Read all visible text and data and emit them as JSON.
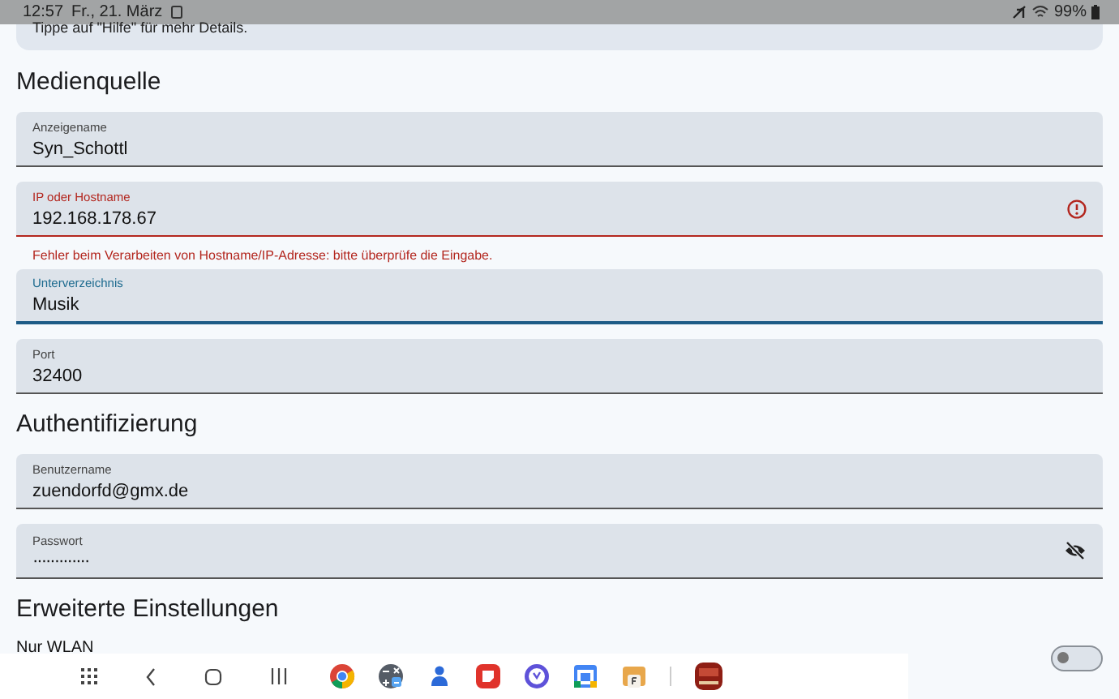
{
  "status_bar": {
    "time": "12:57",
    "date": "Fr., 21. März",
    "battery": "99%"
  },
  "hint_card": {
    "text": "Tippe auf \"Hilfe\" für mehr Details."
  },
  "sections": [
    {
      "title": "Medienquelle",
      "fields": [
        {
          "label": "Anzeigename",
          "value": "Syn_Schottl",
          "error": false,
          "focused": false
        },
        {
          "label": "IP oder Hostname",
          "value": "192.168.178.67",
          "error": true,
          "focused": false,
          "error_text": "Fehler beim Verarbeiten von Hostname/IP-Adresse: bitte überprüfe die Eingabe."
        },
        {
          "label": "Unterverzeichnis",
          "value": "Musik",
          "error": false,
          "focused": true
        },
        {
          "label": "Port",
          "value": "32400",
          "error": false,
          "focused": false
        }
      ]
    },
    {
      "title": "Authentifizierung",
      "fields": [
        {
          "label": "Benutzername",
          "value": "zuendorfd@gmx.de",
          "error": false,
          "focused": false
        },
        {
          "label": "Passwort",
          "value": "·············",
          "error": false,
          "focused": false,
          "password": true
        }
      ]
    },
    {
      "title": "Erweiterte Einstellungen",
      "switches": [
        {
          "label": "Nur WLAN",
          "on": false
        }
      ]
    }
  ],
  "taskbar": {
    "apps": [
      {
        "kind": "chrome"
      },
      {
        "kind": "calculator"
      },
      {
        "kind": "contacts"
      },
      {
        "kind": "notes"
      },
      {
        "kind": "clock"
      },
      {
        "kind": "calendar"
      },
      {
        "kind": "files"
      },
      {
        "kind": "game"
      }
    ]
  }
}
